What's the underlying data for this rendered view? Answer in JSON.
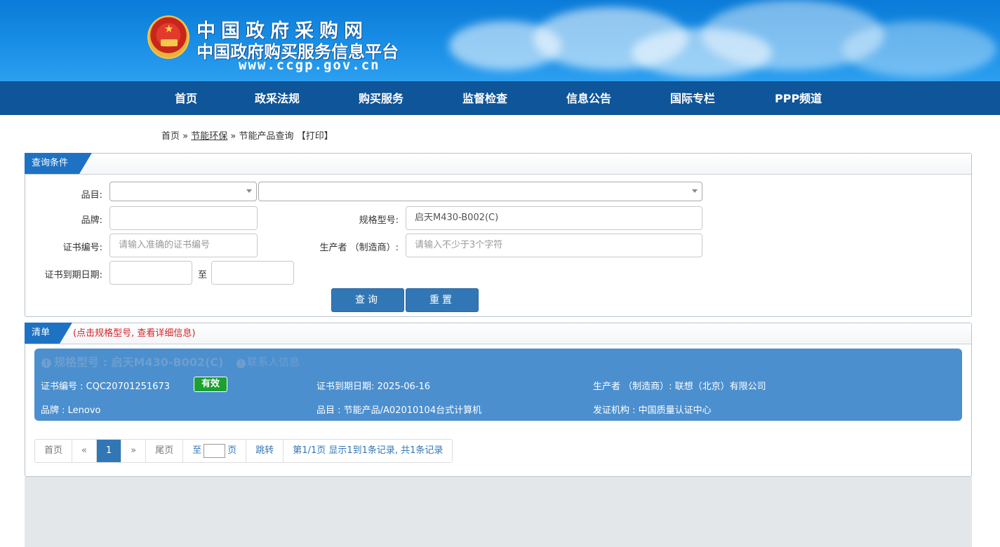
{
  "header": {
    "title_cn": "中国政府采购网",
    "subtitle_cn": "中国政府购买服务信息平台",
    "url": "www.ccgp.gov.cn",
    "emblem_icon": "national-emblem-icon"
  },
  "nav": {
    "items": [
      "首页",
      "政采法规",
      "购买服务",
      "监督检查",
      "信息公告",
      "国际专栏",
      "PPP频道"
    ]
  },
  "breadcrumb": {
    "home": "首页",
    "sep": "»",
    "section": "节能环保",
    "current": "节能产品查询",
    "print": "【打印】"
  },
  "query": {
    "tab": "查询条件",
    "category_label": "品目:",
    "brand_label": "品牌:",
    "brand_value": "",
    "model_label": "规格型号:",
    "model_value": "启天M430-B002(C)",
    "cert_label": "证书编号:",
    "cert_placeholder": "请输入准确的证书编号",
    "maker_label": "生产者 （制造商）:",
    "maker_placeholder": "请输入不少于3个字符",
    "expiry_label": "证书到期日期:",
    "to": "至",
    "search_btn": "查询",
    "reset_btn": "重置"
  },
  "list": {
    "tab": "清单",
    "note": "(点击规格型号, 查看详细信息)",
    "item": {
      "title": "规格型号 : 启天M430-B002(C)",
      "contact": "联系人信息",
      "cert_no": "证书编号 : CQC20701251673",
      "status": "有效",
      "expiry": "证书到期日期: 2025-06-16",
      "maker": "生产者 （制造商）: 联想（北京）有限公司",
      "brand": "品牌 : Lenovo",
      "category": "品目 : 节能产品/A02010104台式计算机",
      "issuer": "发证机构 : 中国质量认证中心",
      "status_color": "#1aa12f"
    }
  },
  "pager": {
    "first": "首页",
    "prev": "«",
    "current": "1",
    "next": "»",
    "last": "尾页",
    "goto_prefix": "至",
    "goto_suffix": "页",
    "jump": "跳转",
    "info": "第1/1页  显示1到1条记录, 共1条记录"
  },
  "colors": {
    "brand_blue": "#0f5599",
    "accent": "#3277b5",
    "card": "#4b8fcf",
    "note_red": "#d2232a"
  }
}
